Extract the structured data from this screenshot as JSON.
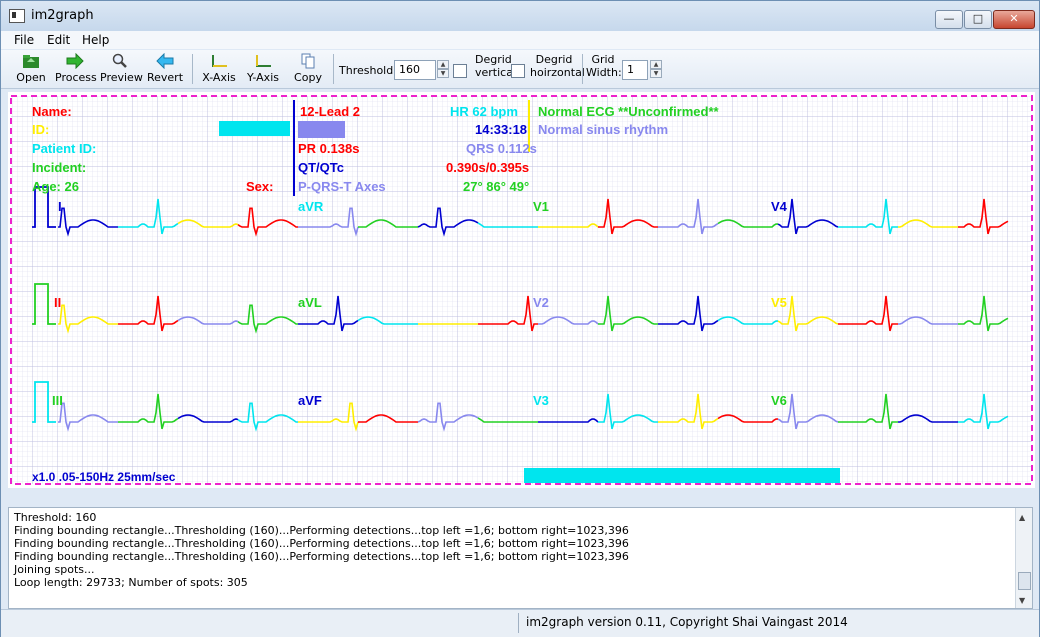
{
  "window": {
    "title": "im2graph",
    "min_glyph": "—",
    "max_glyph": "□",
    "close_glyph": "✕"
  },
  "menu": [
    "File",
    "Edit",
    "Help"
  ],
  "toolbar": {
    "open": "Open",
    "process": "Process",
    "preview": "Preview",
    "revert": "Revert",
    "x_axis": "X-Axis",
    "y_axis": "Y-Axis",
    "copy": "Copy",
    "threshold_label": "Threshold:",
    "threshold_value": "160",
    "degrid_vertical_1": "Degrid",
    "degrid_vertical_2": "vertical",
    "degrid_horizontal_1": "Degrid",
    "degrid_horizontal_2": "hoirzontal",
    "grid_width_1": "Grid",
    "grid_width_2": "Width:",
    "grid_width_value": "1"
  },
  "ecg": {
    "name": "Name:",
    "id": "ID:",
    "patient_id": "Patient ID:",
    "incident": "Incident:",
    "age": "Age: 26",
    "sex": "Sex:",
    "lead": "12-Lead 2",
    "pr": "PR 0.138s",
    "qt": "QT/QTc",
    "p_axes": "P-QRS-T Axes",
    "avr": "aVR",
    "hr": "HR 62 bpm",
    "time": "14:33:18",
    "qrs": "QRS 0.112s",
    "qt_value": "0.390s/0.395s",
    "axes_value": "27° 86° 49°",
    "interp1": "Normal ECG **Unconfirmed**",
    "interp2": "Normal sinus rhythm",
    "lead_i": "I",
    "lead_ii": "II",
    "lead_iii": "III",
    "lead_avl": "aVL",
    "lead_avf": "aVF",
    "lead_v1": "V1",
    "lead_v2": "V2",
    "lead_v3": "V3",
    "lead_v4": "V4",
    "lead_v5": "V5",
    "lead_v6": "V6",
    "footer": "x1.0 .05-150Hz 25mm/sec"
  },
  "log_lines": [
    "Threshold: 160",
    "Finding bounding rectangle...Thresholding (160)...Performing detections...top left =1,6; bottom right=1023,396",
    "Finding bounding rectangle...Thresholding (160)...Performing detections...top left =1,6; bottom right=1023,396",
    "Finding bounding rectangle...Thresholding (160)...Performing detections...top left =1,6; bottom right=1023,396",
    "Joining spots...",
    "Loop length: 29733; Number of spots: 305"
  ],
  "status": "im2graph version 0.11, Copyright Shai Vaingast 2014",
  "colors": {
    "red": "#ff0000",
    "green": "#22d022",
    "blue": "#0000d0",
    "cyan": "#00e5ee",
    "yellow": "#ffee00",
    "purple": "#8888ee",
    "magenta": "#ee22cc",
    "grid": "#c8c8e6"
  }
}
